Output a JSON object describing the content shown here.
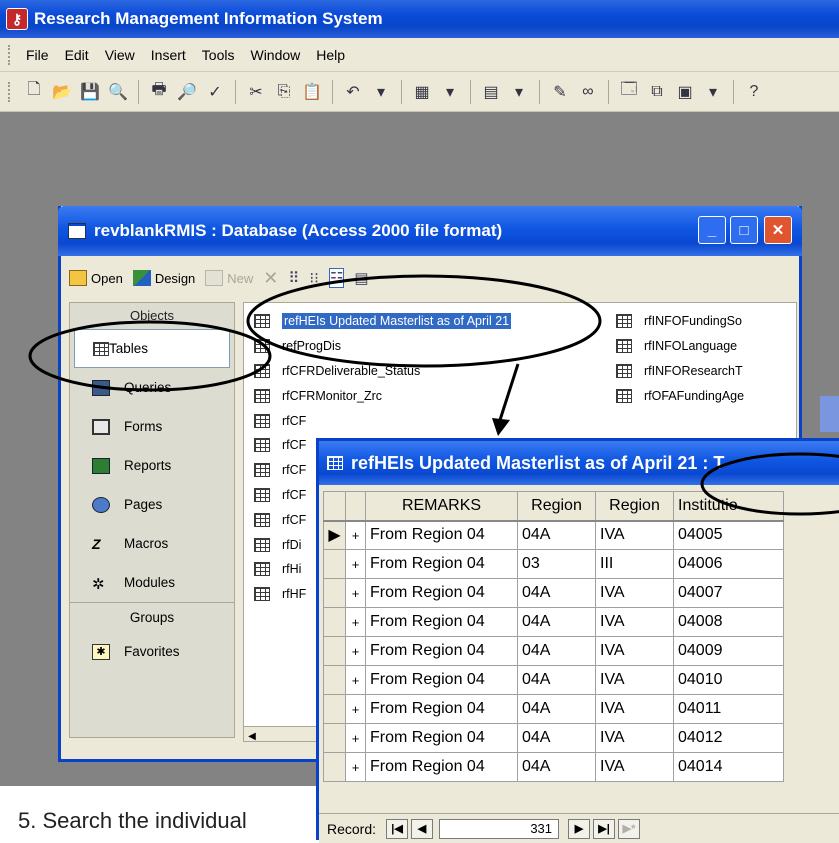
{
  "app": {
    "title": "Research Management Information System",
    "menu": [
      "File",
      "Edit",
      "View",
      "Insert",
      "Tools",
      "Window",
      "Help"
    ]
  },
  "db_window": {
    "title": "revblankRMIS : Database (Access 2000 file format)",
    "toolbar": {
      "open": "Open",
      "design": "Design",
      "new": "New"
    },
    "objects_header": "Objects",
    "objects": [
      {
        "label": "Tables",
        "icon": "table-icon"
      },
      {
        "label": "Queries",
        "icon": "query-icon"
      },
      {
        "label": "Forms",
        "icon": "form-icon"
      },
      {
        "label": "Reports",
        "icon": "report-icon"
      },
      {
        "label": "Pages",
        "icon": "page-icon"
      },
      {
        "label": "Macros",
        "icon": "macro-icon"
      },
      {
        "label": "Modules",
        "icon": "module-icon"
      }
    ],
    "groups_header": "Groups",
    "groups": [
      {
        "label": "Favorites",
        "icon": "favorites-icon"
      }
    ],
    "tables_col1": [
      "refHEIs Updated Masterlist as of April 21",
      "refProgDis",
      "rfCFRDeliverable_Status",
      "rfCFRMonitor_Zrc",
      "rfCF",
      "rfCF",
      "rfCF",
      "rfCF",
      "rfCF",
      "rfDi",
      "rfHi",
      "rfHF"
    ],
    "tables_col2": [
      "rfINFOFundingSo",
      "rfINFOLanguage",
      "rfINFOResearchT",
      "rfOFAFundingAge"
    ]
  },
  "table_window": {
    "title": "refHEIs Updated Masterlist as of April 21 : T",
    "columns": [
      "REMARKS",
      "Region",
      "Region",
      "Institutio"
    ],
    "rows": [
      [
        "From Region 04",
        "04A",
        "IVA",
        "04005"
      ],
      [
        "From Region 04",
        "03",
        "III",
        "04006"
      ],
      [
        "From Region 04",
        "04A",
        "IVA",
        "04007"
      ],
      [
        "From Region 04",
        "04A",
        "IVA",
        "04008"
      ],
      [
        "From Region 04",
        "04A",
        "IVA",
        "04009"
      ],
      [
        "From Region 04",
        "04A",
        "IVA",
        "04010"
      ],
      [
        "From Region 04",
        "04A",
        "IVA",
        "04011"
      ],
      [
        "From Region 04",
        "04A",
        "IVA",
        "04012"
      ],
      [
        "From Region 04",
        "04A",
        "IVA",
        "04014"
      ]
    ],
    "record_label": "Record:",
    "record_number": "331"
  },
  "bottom_text": "5. Search the individual",
  "colors": {
    "title_blue": "#0a48d0",
    "highlight": "#316ac5",
    "workspace": "#838383"
  }
}
